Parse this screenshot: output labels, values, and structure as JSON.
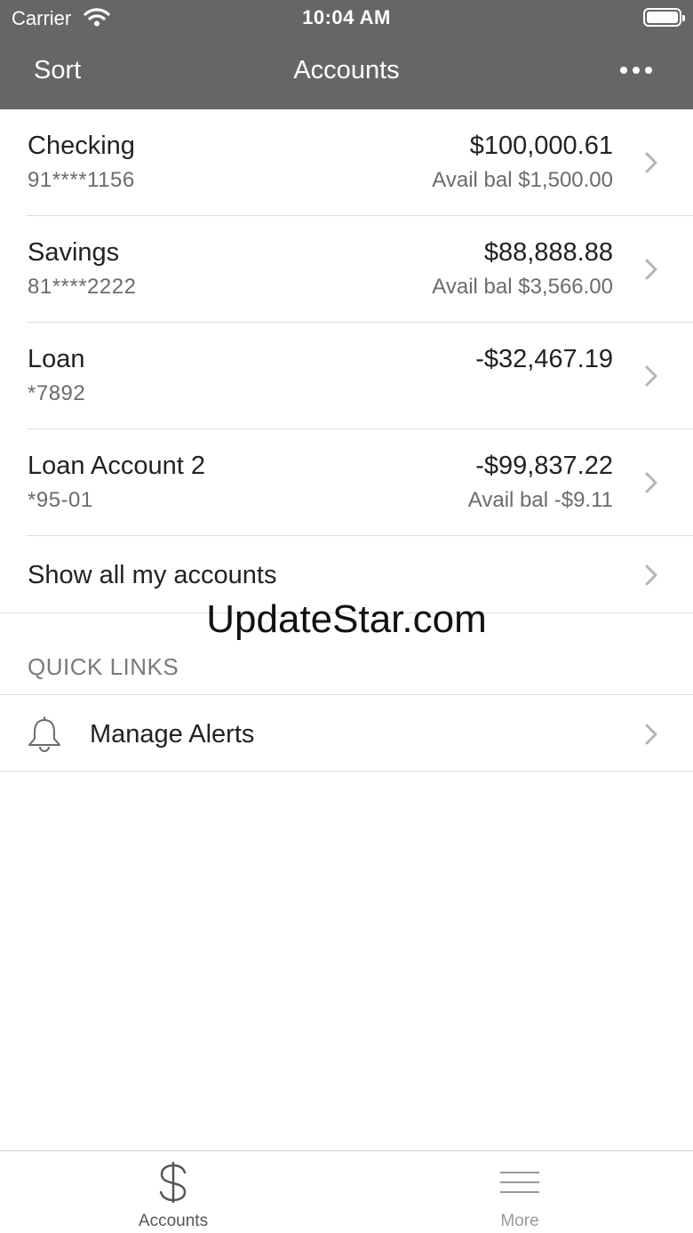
{
  "status_bar": {
    "carrier": "Carrier",
    "time": "10:04 AM"
  },
  "nav": {
    "left_button": "Sort",
    "title": "Accounts",
    "right_icon": "more-horizontal-icon"
  },
  "accounts": [
    {
      "name": "Checking",
      "number": "91****1156",
      "balance": "$100,000.61",
      "avail": "Avail bal $1,500.00"
    },
    {
      "name": "Savings",
      "number": "81****2222",
      "balance": "$88,888.88",
      "avail": "Avail bal $3,566.00"
    },
    {
      "name": "Loan",
      "number": "*7892",
      "balance": "-$32,467.19",
      "avail": ""
    },
    {
      "name": "Loan Account 2",
      "number": "*95-01",
      "balance": "-$99,837.22",
      "avail": "Avail bal -$9.11"
    }
  ],
  "show_all": {
    "label": "Show all my accounts"
  },
  "watermark": "UpdateStar.com",
  "quick_links": {
    "header": "QUICK LINKS",
    "items": [
      {
        "label": "Manage Alerts",
        "icon": "bell-icon"
      }
    ]
  },
  "tabbar": {
    "accounts_label": "Accounts",
    "more_label": "More"
  },
  "colors": {
    "header_bg": "#666666",
    "separator": "#dcdcdc",
    "secondary_text": "#6b6b6b",
    "chevron": "#b5b5b5"
  }
}
